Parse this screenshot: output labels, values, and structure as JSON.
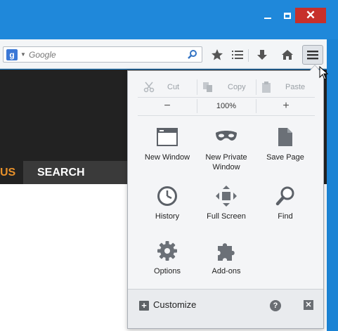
{
  "window": {
    "minimize_icon": "minimize-icon",
    "maximize_icon": "maximize-icon",
    "close_icon": "close-icon",
    "close_glyph": "✕"
  },
  "search": {
    "placeholder": "Google",
    "engine_badge": "g"
  },
  "page": {
    "nav": [
      {
        "label": "US"
      },
      {
        "label": "SEARCH"
      }
    ]
  },
  "menu": {
    "edit": {
      "cut": "Cut",
      "copy": "Copy",
      "paste": "Paste"
    },
    "zoom": {
      "minus": "−",
      "value": "100%",
      "plus": "+"
    },
    "items": [
      {
        "label": "New Window",
        "icon": "new-window-icon"
      },
      {
        "label": "New Private Window",
        "icon": "private-mask-icon"
      },
      {
        "label": "Save Page",
        "icon": "save-page-icon"
      },
      {
        "label": "History",
        "icon": "history-clock-icon"
      },
      {
        "label": "Full Screen",
        "icon": "fullscreen-icon"
      },
      {
        "label": "Find",
        "icon": "find-magnifier-icon"
      },
      {
        "label": "Options",
        "icon": "gear-icon"
      },
      {
        "label": "Add-ons",
        "icon": "puzzle-icon"
      }
    ],
    "footer": {
      "customize": "Customize",
      "customize_glyph": "+",
      "help_glyph": "?",
      "close_glyph": "✕"
    }
  },
  "colors": {
    "titlebar": "#1f88da",
    "close": "#c7302b",
    "accent_nav": "#e8912b"
  }
}
